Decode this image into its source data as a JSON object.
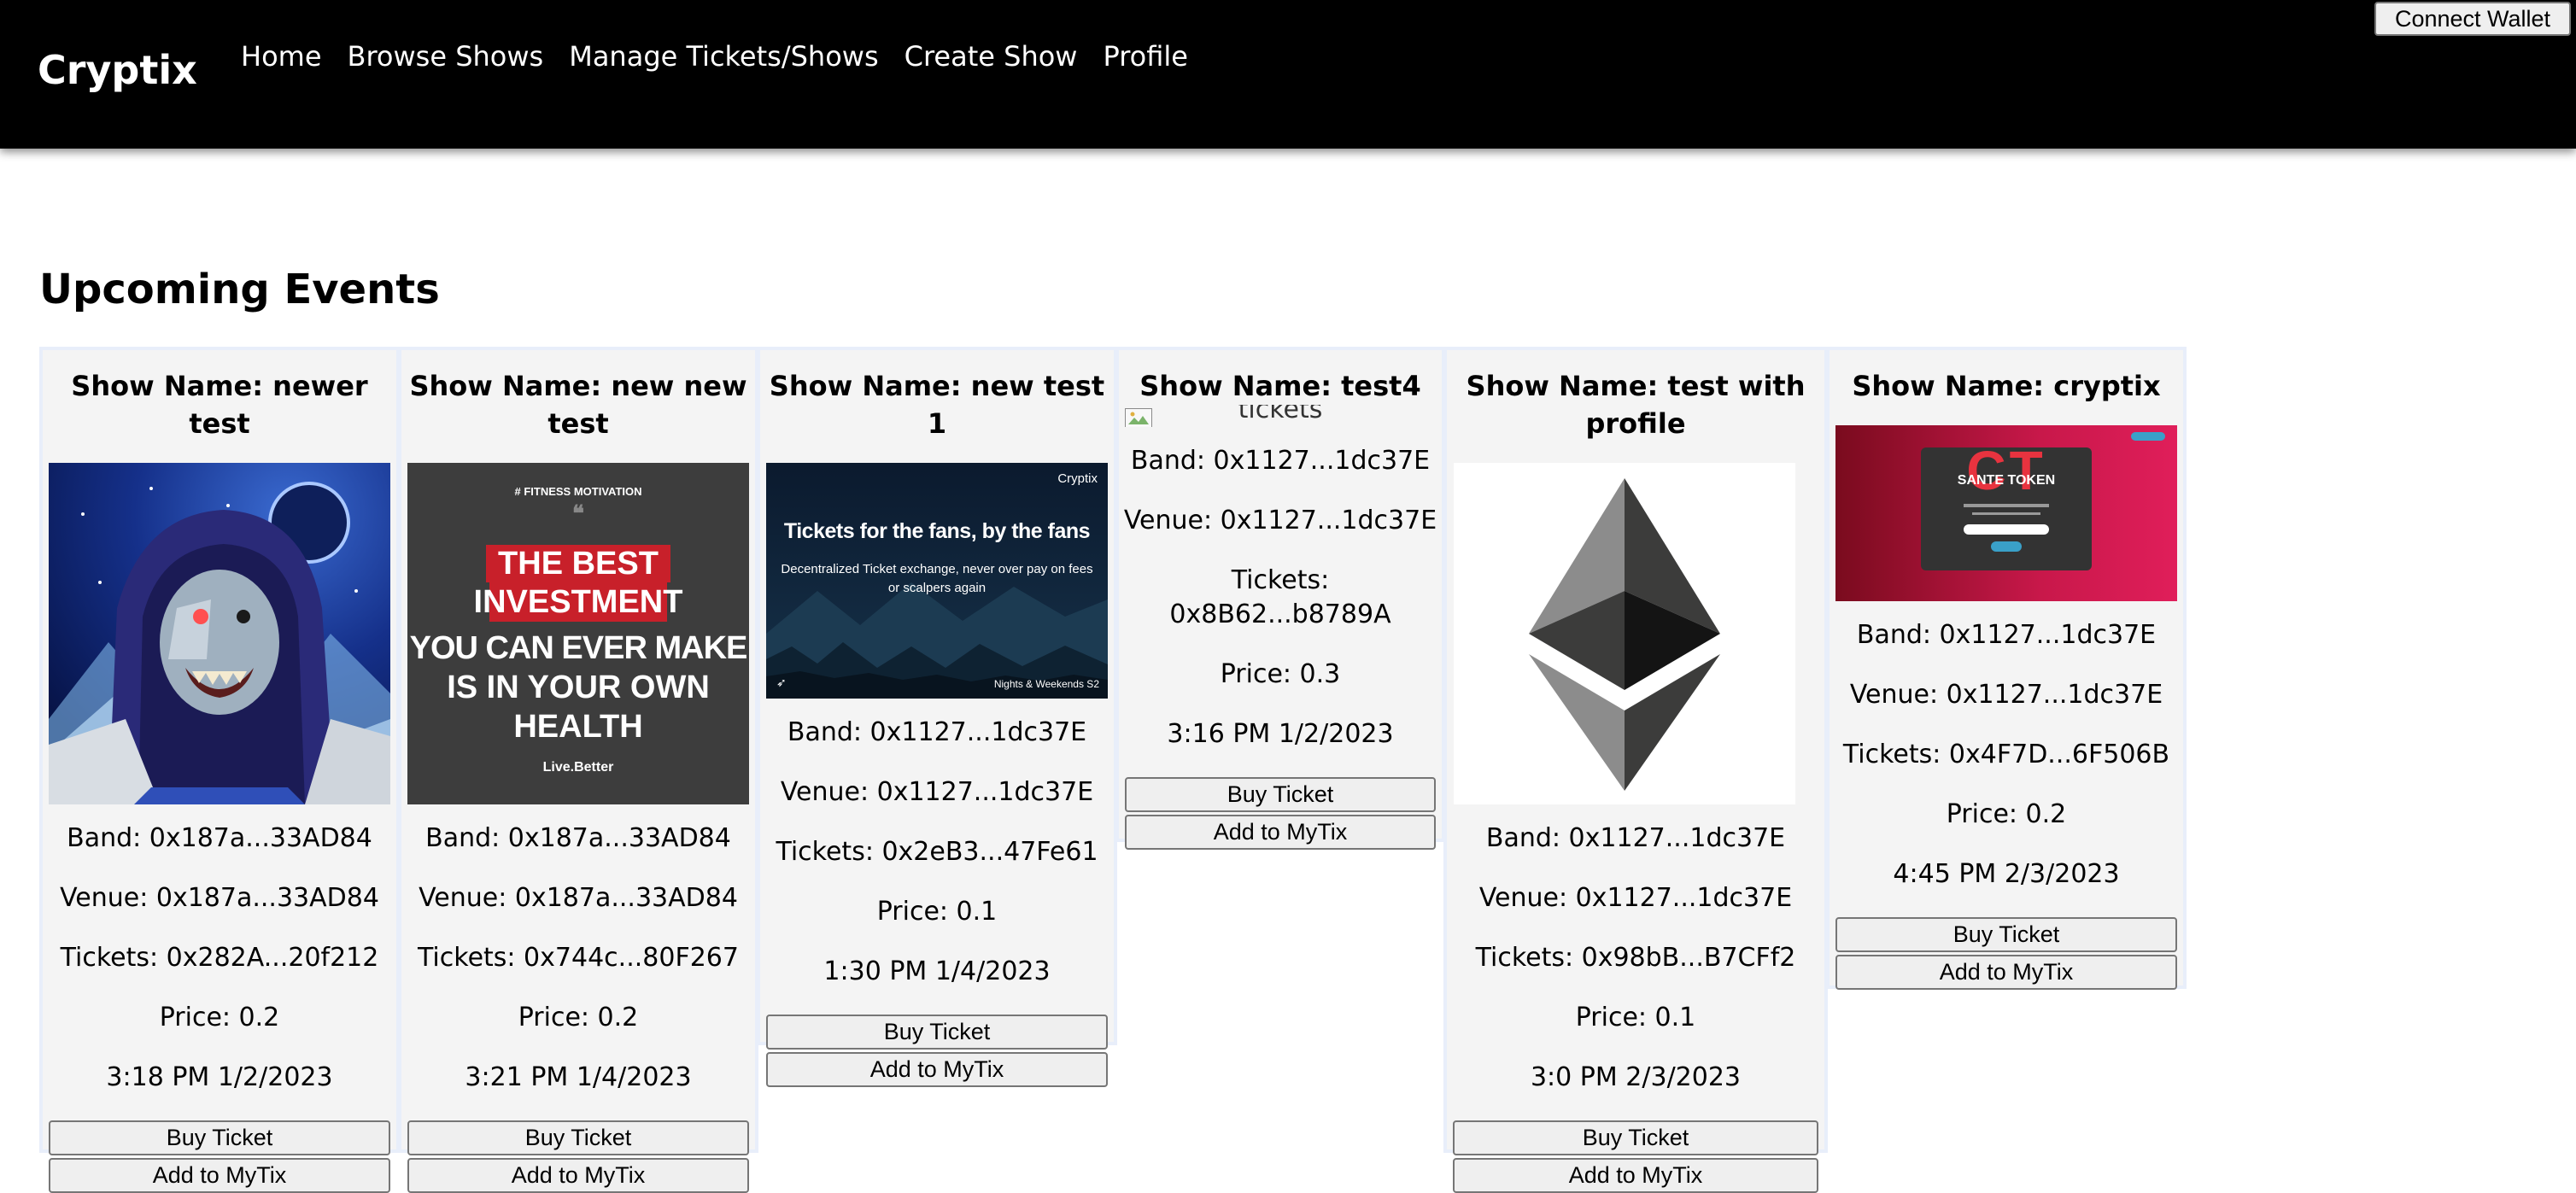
{
  "app": {
    "brand": "Cryptix"
  },
  "nav": {
    "items": [
      "Home",
      "Browse Shows",
      "Manage Tickets/Shows",
      "Create Show",
      "Profile"
    ],
    "connect_label": "Connect Wallet"
  },
  "main": {
    "heading": "Upcoming Events"
  },
  "labels": {
    "buy": "Buy Ticket",
    "add": "Add to MyTix"
  },
  "events": [
    {
      "title": "Show Name: newer test",
      "image": "cyber-gorilla-art",
      "band": "Band: 0x187a...33AD84",
      "venue": "Venue: 0x187a...33AD84",
      "tickets": "Tickets: 0x282A...20f212",
      "price": "Price: 0.2",
      "datetime": "3:18 PM 1/2/2023"
    },
    {
      "title": "Show Name: new new test",
      "image": "motivation-poster",
      "image_text": {
        "tag": "# FITNESS MOTIVATION",
        "line1": "THE BEST",
        "line2": "INVESTMENT",
        "line3": "YOU CAN EVER MAKE",
        "line4": "IS IN YOUR OWN",
        "line5": "HEALTH",
        "footer": "Live.Better"
      },
      "band": "Band: 0x187a...33AD84",
      "venue": "Venue: 0x187a...33AD84",
      "tickets": "Tickets: 0x744c...80F267",
      "price": "Price: 0.2",
      "datetime": "3:21 PM 1/4/2023"
    },
    {
      "title": "Show Name: new test 1",
      "image": "cryptix-banner",
      "image_text": {
        "brand": "Cryptix",
        "headline": "Tickets for the fans, by the fans",
        "sub": "Decentralized Ticket exchange, never over pay on fees or scalpers again",
        "footer": "Nights & Weekends S2"
      },
      "band": "Band: 0x1127...1dc37E",
      "venue": "Venue: 0x1127...1dc37E",
      "tickets": "Tickets: 0x2eB3...47Fe61",
      "price": "Price: 0.1",
      "datetime": "1:30 PM 1/4/2023"
    },
    {
      "title": "Show Name: test4",
      "image": "broken-image",
      "image_alt": "tickets",
      "band": "Band: 0x1127...1dc37E",
      "venue": "Venue: 0x1127...1dc37E",
      "tickets": "Tickets: 0x8B62...b8789A",
      "price": "Price: 0.3",
      "datetime": "3:16 PM 1/2/2023"
    },
    {
      "title": "Show Name: test with profile",
      "image": "ethereum-logo",
      "band": "Band: 0x1127...1dc37E",
      "venue": "Venue: 0x1127...1dc37E",
      "tickets": "Tickets: 0x98bB...B7CFf2",
      "price": "Price: 0.1",
      "datetime": "3:0 PM 2/3/2023"
    },
    {
      "title": "Show Name: cryptix",
      "image": "sante-token-screenshot",
      "image_text": {
        "logo": "CT",
        "token": "SANTE TOKEN"
      },
      "band": "Band: 0x1127...1dc37E",
      "venue": "Venue: 0x1127...1dc37E",
      "tickets": "Tickets: 0x4F7D...6F506B",
      "price": "Price: 0.2",
      "datetime": "4:45 PM 2/3/2023"
    }
  ]
}
